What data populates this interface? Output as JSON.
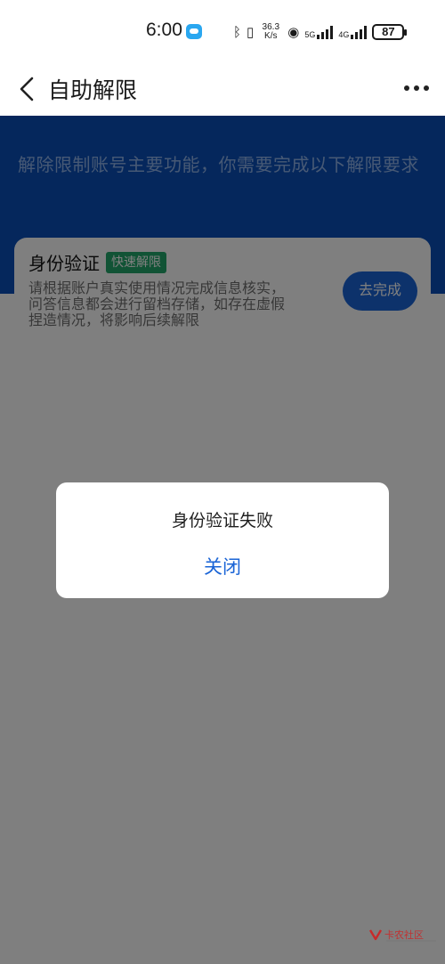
{
  "status_bar": {
    "time": "6:00",
    "bluetooth_icon": "bluetooth-icon",
    "vibrate_icon": "vibrate-icon",
    "net_speed_value": "36.3",
    "net_speed_unit": "K/s",
    "hotspot_icon": "hotspot-icon",
    "sim1_label": "5G",
    "sim2_label": "4G",
    "battery": "87"
  },
  "nav": {
    "back_icon": "back-arrow-icon",
    "title": "自助解限",
    "more_icon": "more-dots-icon"
  },
  "hero": {
    "text": "解除限制账号主要功能，你需要完成以下解限要求"
  },
  "card": {
    "title": "身份验证",
    "badge": "快速解限",
    "description": "请根据账户真实使用情况完成信息核实，问答信息都会进行留档存储，如存在虚假捏造情况，将影响后续解限",
    "button": "去完成"
  },
  "dialog": {
    "message": "身份验证失败",
    "close_label": "关闭"
  },
  "watermark": {
    "text": "卡农社区"
  },
  "colors": {
    "hero_blue": "#0b4fb8",
    "accent_blue": "#1a64d6",
    "badge_green": "#22a66a",
    "overlay": "rgba(0,0,0,0.5)"
  }
}
